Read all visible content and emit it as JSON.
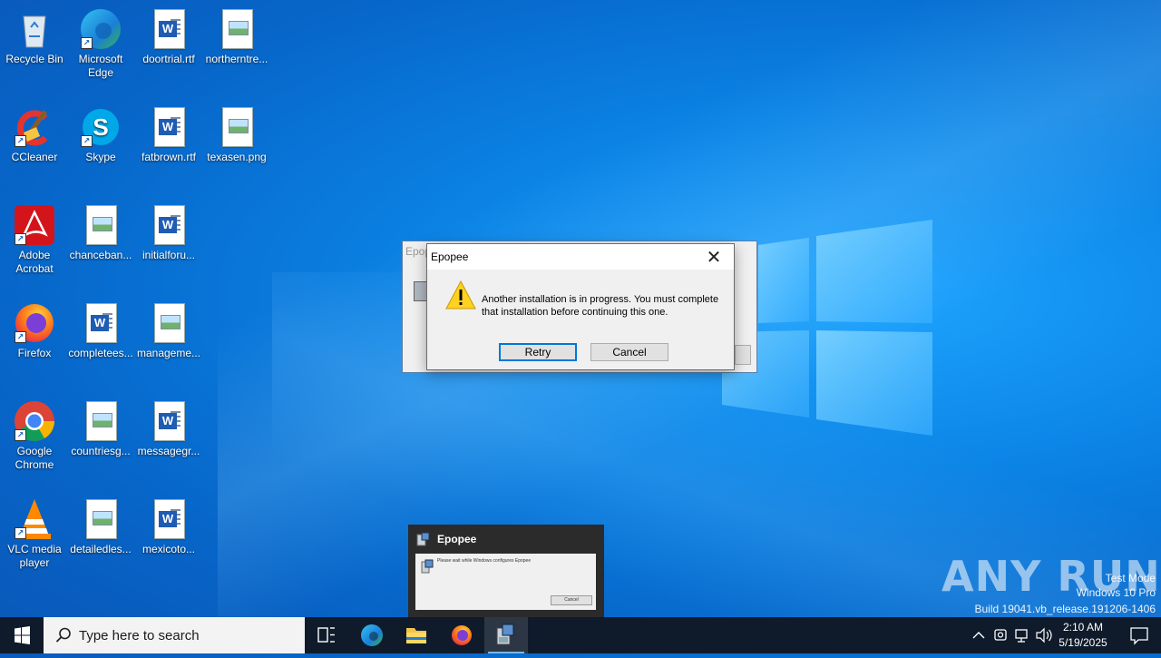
{
  "desktop": {
    "icons": [
      {
        "label": "Recycle Bin",
        "icon": "recycle-bin-icon"
      },
      {
        "label": "Microsoft Edge",
        "icon": "edge-icon"
      },
      {
        "label": "doortrial.rtf",
        "icon": "word-document-icon"
      },
      {
        "label": "northerntre...",
        "icon": "image-file-icon"
      },
      {
        "label": "CCleaner",
        "icon": "ccleaner-icon"
      },
      {
        "label": "Skype",
        "icon": "skype-icon"
      },
      {
        "label": "fatbrown.rtf",
        "icon": "word-document-icon"
      },
      {
        "label": "texasen.png",
        "icon": "image-file-icon"
      },
      {
        "label": "Adobe Acrobat",
        "icon": "acrobat-icon"
      },
      {
        "label": "chanceban...",
        "icon": "image-file-icon"
      },
      {
        "label": "initialforu...",
        "icon": "word-document-icon"
      },
      {
        "label": "Firefox",
        "icon": "firefox-icon"
      },
      {
        "label": "completees...",
        "icon": "word-document-icon"
      },
      {
        "label": "manageme...",
        "icon": "image-file-icon"
      },
      {
        "label": "Google Chrome",
        "icon": "chrome-icon"
      },
      {
        "label": "countriesg...",
        "icon": "image-file-icon"
      },
      {
        "label": "messagegr...",
        "icon": "word-document-icon"
      },
      {
        "label": "VLC media player",
        "icon": "vlc-icon"
      },
      {
        "label": "detailedles...",
        "icon": "image-file-icon"
      },
      {
        "label": "mexicoto...",
        "icon": "word-document-icon"
      }
    ]
  },
  "background_window": {
    "title": "Epop"
  },
  "dialog": {
    "title": "Epopee",
    "message": "Another installation is in progress. You must complete that installation before continuing this one.",
    "retry_label": "Retry",
    "cancel_label": "Cancel",
    "close_glyph": "✕"
  },
  "preview": {
    "title": "Epopee",
    "thumb_text": "Please wait while Windows configures Epopee",
    "thumb_button": "Cancel"
  },
  "watermark": {
    "brand": "ANY RUN",
    "line1": "Test Mode",
    "line2": "Windows 10 Pro",
    "line3": "Build 19041.vb_release.191206-1406"
  },
  "taskbar": {
    "search_placeholder": "Type here to search",
    "time": "2:10 AM",
    "date": "5/19/2025"
  },
  "colors": {
    "accent": "#0078d7",
    "taskbar": "#0f1b2b",
    "desktop": "#0b84e6"
  }
}
